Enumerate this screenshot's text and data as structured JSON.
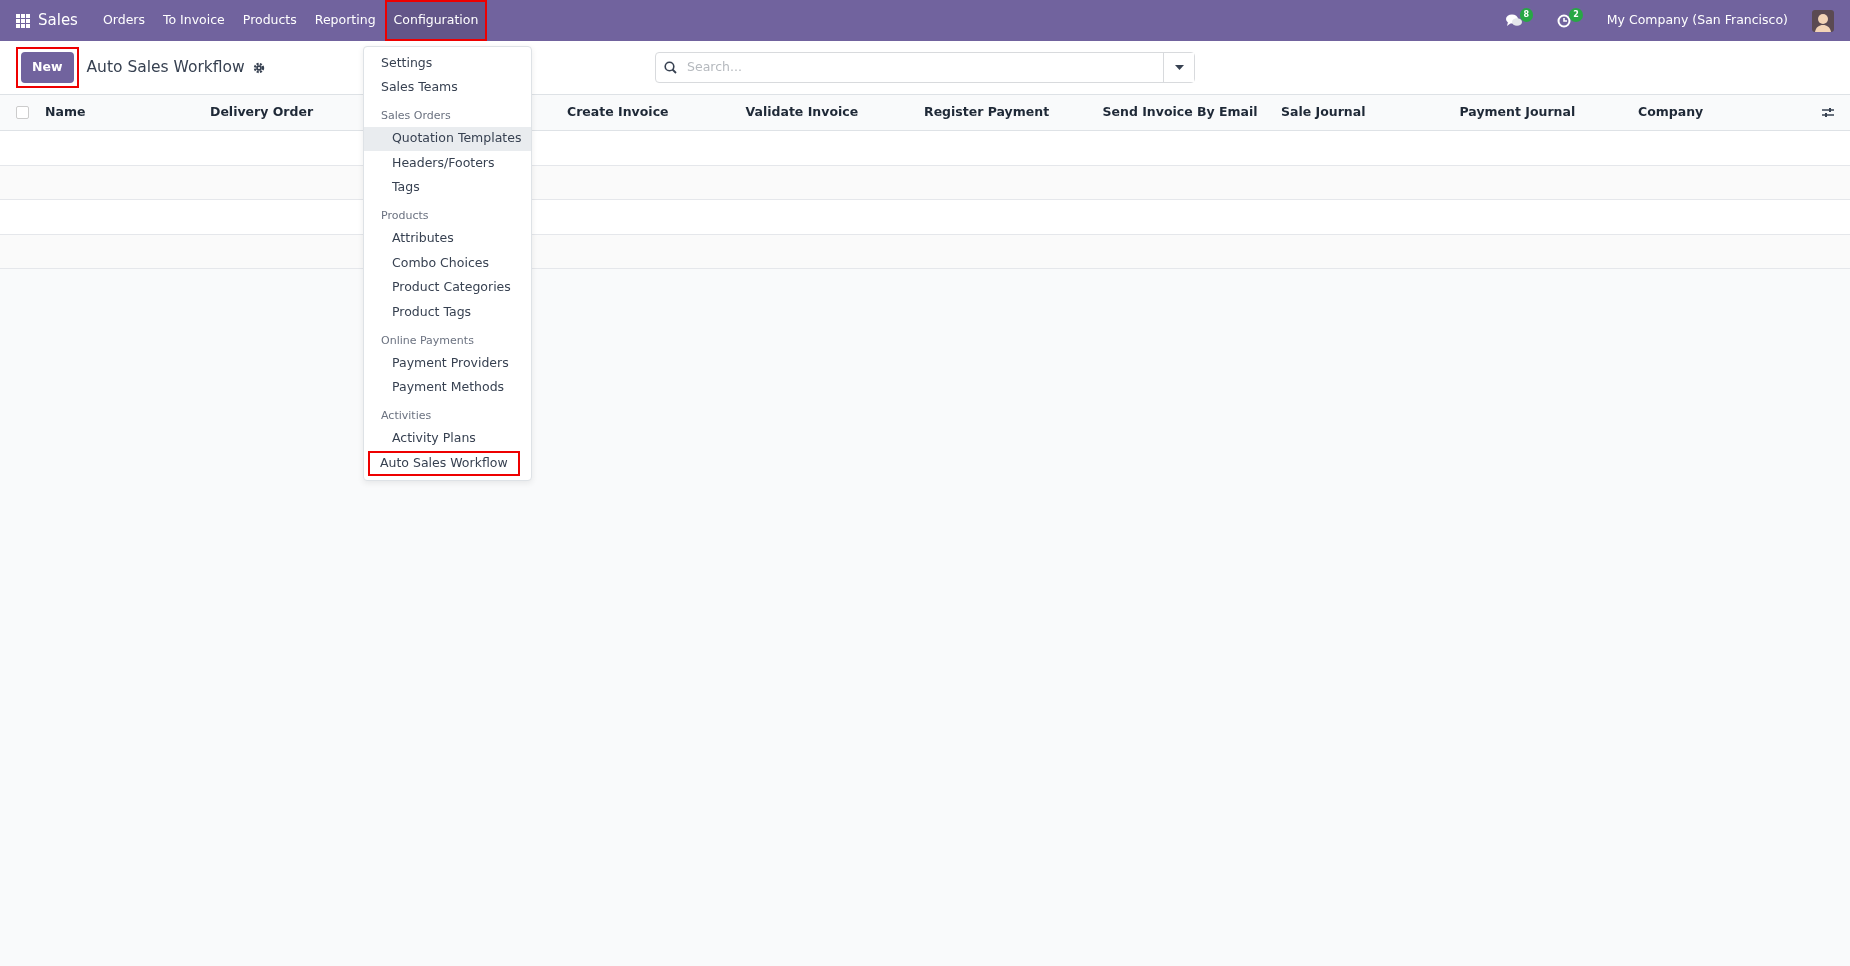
{
  "navbar": {
    "app_name": "Sales",
    "menus": [
      {
        "label": "Orders",
        "open": false,
        "highlighted": false
      },
      {
        "label": "To Invoice",
        "open": false,
        "highlighted": false
      },
      {
        "label": "Products",
        "open": false,
        "highlighted": false
      },
      {
        "label": "Reporting",
        "open": false,
        "highlighted": false
      },
      {
        "label": "Configuration",
        "open": true,
        "highlighted": true
      }
    ],
    "messages_badge": "8",
    "activities_badge": "2",
    "company": "My Company (San Francisco)"
  },
  "control_panel": {
    "new_button": {
      "label": "New",
      "highlighted": true
    },
    "title": "Auto Sales Workflow",
    "search": {
      "placeholder": "Search..."
    }
  },
  "dropdown_menu": {
    "items": [
      {
        "kind": "item",
        "label": "Settings",
        "selected": false,
        "highlighted": false
      },
      {
        "kind": "item",
        "label": "Sales Teams",
        "selected": false,
        "highlighted": false
      },
      {
        "kind": "header",
        "label": "Sales Orders"
      },
      {
        "kind": "subitem",
        "label": "Quotation Templates",
        "selected": true,
        "highlighted": false
      },
      {
        "kind": "subitem",
        "label": "Headers/Footers",
        "selected": false,
        "highlighted": false
      },
      {
        "kind": "subitem",
        "label": "Tags",
        "selected": false,
        "highlighted": false
      },
      {
        "kind": "header",
        "label": "Products"
      },
      {
        "kind": "subitem",
        "label": "Attributes",
        "selected": false,
        "highlighted": false
      },
      {
        "kind": "subitem",
        "label": "Combo Choices",
        "selected": false,
        "highlighted": false
      },
      {
        "kind": "subitem",
        "label": "Product Categories",
        "selected": false,
        "highlighted": false
      },
      {
        "kind": "subitem",
        "label": "Product Tags",
        "selected": false,
        "highlighted": false
      },
      {
        "kind": "header",
        "label": "Online Payments"
      },
      {
        "kind": "subitem",
        "label": "Payment Providers",
        "selected": false,
        "highlighted": false
      },
      {
        "kind": "subitem",
        "label": "Payment Methods",
        "selected": false,
        "highlighted": false
      },
      {
        "kind": "header",
        "label": "Activities"
      },
      {
        "kind": "subitem",
        "label": "Activity Plans",
        "selected": false,
        "highlighted": false
      },
      {
        "kind": "item",
        "label": "Auto Sales Workflow",
        "selected": false,
        "highlighted": true
      }
    ]
  },
  "table": {
    "select_all_checked": false,
    "columns": [
      "Name",
      "Delivery Order",
      "Create Invoice",
      "Validate Invoice",
      "Register Payment",
      "Send Invoice By Email",
      "Sale Journal",
      "Payment Journal",
      "Company"
    ]
  }
}
